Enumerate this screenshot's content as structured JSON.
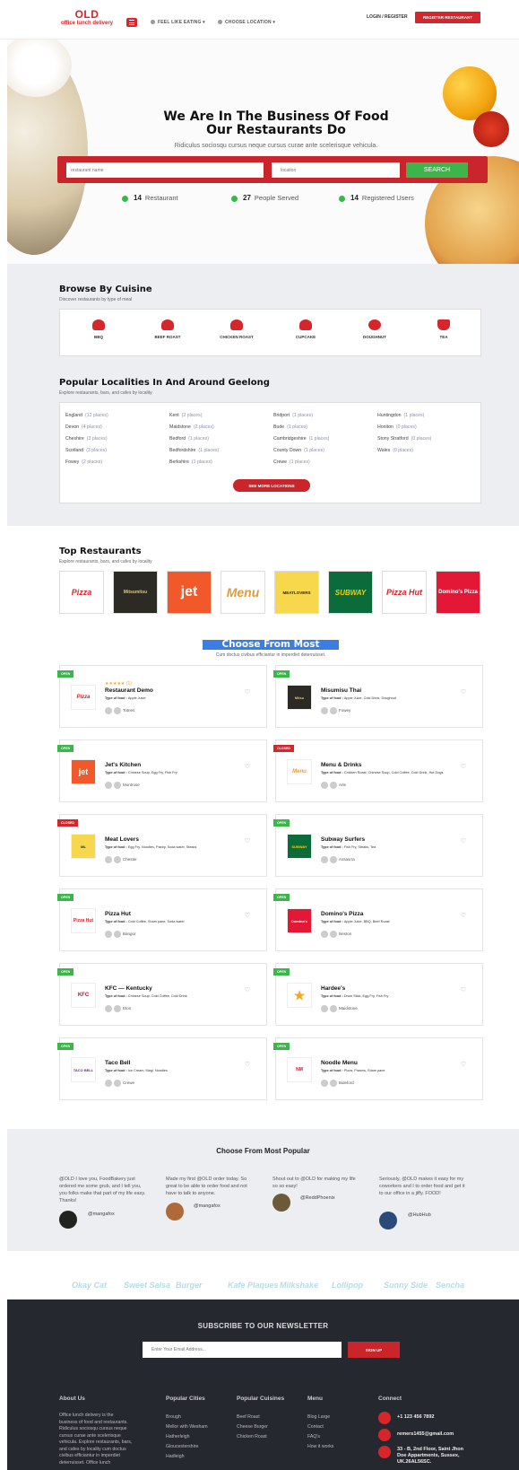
{
  "header": {
    "logo_main": "OLD",
    "logo_sub": "office lunch delivery",
    "nav_eating": "FEEL LIKE EATING",
    "nav_location": "CHOOSE LOCATION",
    "login": "LOGIN / REGISTER",
    "register": "REGISTER RESTAURANT"
  },
  "hero": {
    "title_line1": "We Are In The Business Of Food",
    "title_line2": "Our Restaurants Do",
    "subtitle": "Ridiculus sociosqu cursus neque cursus curae ante scelerisque vehicula.",
    "search_placeholder": "restaurant name",
    "location_placeholder": "location",
    "search_button": "SEARCH",
    "stats": [
      {
        "num": "14",
        "label": "Restaurant"
      },
      {
        "num": "27",
        "label": "People Served"
      },
      {
        "num": "14",
        "label": "Registered Users"
      }
    ]
  },
  "cuisine": {
    "title": "Browse By Cuisine",
    "subtitle": "Discover restaurants by type of meal",
    "items": [
      "BBQ",
      "BEEF ROAST",
      "CHICKEN ROAST",
      "CUPCAKE",
      "DOUGHNUT",
      "TEA"
    ]
  },
  "localities": {
    "title": "Popular Localities In And Around Geelong",
    "subtitle": "Explore restaurants, bars, and cafes by locality",
    "button": "SEE MORE LOCATIONS",
    "items": [
      [
        {
          "n": "England",
          "c": "(12 places)"
        },
        {
          "n": "Devon",
          "c": "(4 places)"
        },
        {
          "n": "Cheshire",
          "c": "(3 places)"
        },
        {
          "n": "Scotland",
          "c": "(3 places)"
        },
        {
          "n": "Fowey",
          "c": "(2 places)"
        }
      ],
      [
        {
          "n": "Kent",
          "c": "(2 places)"
        },
        {
          "n": "Maidstone",
          "c": "(2 places)"
        },
        {
          "n": "Bedford",
          "c": "(1 places)"
        },
        {
          "n": "Bedfordshire",
          "c": "(1 places)"
        },
        {
          "n": "Berkshire",
          "c": "(1 places)"
        }
      ],
      [
        {
          "n": "Bridport",
          "c": "(1 places)"
        },
        {
          "n": "Bude",
          "c": "(1 places)"
        },
        {
          "n": "Cambridgeshire",
          "c": "(1 places)"
        },
        {
          "n": "County Down",
          "c": "(1 places)"
        },
        {
          "n": "Crewe",
          "c": "(1 places)"
        }
      ],
      [
        {
          "n": "Huntingdon",
          "c": "(1 places)"
        },
        {
          "n": "Honiton",
          "c": "(0 places)"
        },
        {
          "n": "Stony Stratford",
          "c": "(0 places)"
        },
        {
          "n": "Wales",
          "c": "(0 places)"
        }
      ]
    ]
  },
  "top": {
    "title": "Top Restaurants",
    "subtitle": "Explore restaurants, bars, and cafes by locality",
    "logos": [
      "Pizza",
      "Mitsumitsu",
      "jet",
      "Menu",
      "MEATLOVERS",
      "SUBWAY",
      "Pizza Hut",
      "Domino's Pizza"
    ]
  },
  "popular": {
    "title": "Choose From Most Popular",
    "subtitle": "Cum doctus civibus efficiantur in imperdiet deterruisset.",
    "cards": [
      {
        "tag": "OPEN",
        "status": "open",
        "name": "Restaurant Demo",
        "type_label": "Type of food : ",
        "type": "Apple Juice",
        "place": "Totnes",
        "logo": "Pizza",
        "stars": "★★★★★ (1)"
      },
      {
        "tag": "OPEN",
        "status": "open",
        "name": "Misumisu Thai",
        "type_label": "Type of food : ",
        "type": "Apple Juice, Cold Drink, Doughnut",
        "place": "Fowey",
        "logo": "Mitsu"
      },
      {
        "tag": "OPEN",
        "status": "open",
        "name": "Jet's Kitchen",
        "type_label": "Type of food : ",
        "type": "Chinese Soup, Egg Fry, Fish Fry",
        "place": "Montrose",
        "logo": "jet"
      },
      {
        "tag": "CLOSED",
        "status": "closed",
        "name": "Menu & Drinks",
        "type_label": "Type of food : ",
        "type": "Chicken Roast, Chinese Soup, Cold Coffee, Cold Drink, Hot Dogs",
        "place": "Arle",
        "logo": "Menu"
      },
      {
        "tag": "CLOSED",
        "status": "closed",
        "name": "Meat Lovers",
        "type_label": "Type of food : ",
        "type": "Egg Fry, Noodles, Pastry, Soda water, Steaks",
        "place": "Chester",
        "logo": "ML"
      },
      {
        "tag": "OPEN",
        "status": "open",
        "name": "Subway Surfers",
        "type_label": "Type of food : ",
        "type": "Fish Fry, Steaks, Tea",
        "place": "Assasrra",
        "logo": "SUBWAY"
      },
      {
        "tag": "OPEN",
        "status": "open",
        "name": "Pizza Hut",
        "type_label": "Type of food : ",
        "type": "Cold Coffee, Sham pane, Soda water",
        "place": "Bangor",
        "logo": "Pizza Hut"
      },
      {
        "tag": "OPEN",
        "status": "open",
        "name": "Domino's Pizza",
        "type_label": "Type of food : ",
        "type": "Apple Juice, BBQ, Beef Roast",
        "place": "Neston",
        "logo": "Domino's"
      },
      {
        "tag": "OPEN",
        "status": "open",
        "name": "KFC — Kentucky",
        "type_label": "Type of food : ",
        "type": "Chinese Soup, Cold Coffee, Cold Drink",
        "place": "Eton",
        "logo": "KFC"
      },
      {
        "tag": "OPEN",
        "status": "open",
        "name": "Hardee's",
        "type_label": "Type of food : ",
        "type": "Drum Stick, Egg Fry, Fish Fry",
        "place": "Maidstone",
        "logo": "★"
      },
      {
        "tag": "OPEN",
        "status": "open",
        "name": "Taco Bell",
        "type_label": "Type of food : ",
        "type": "Ice Cream, Magi, Noodles",
        "place": "Crewe",
        "logo": "TACO BELL"
      },
      {
        "tag": "OPEN",
        "status": "open",
        "name": "Noodle Menu",
        "type_label": "Type of food : ",
        "type": "Pizza, Prawns, Sham pane",
        "place": "Bideford",
        "logo": "NM"
      }
    ]
  },
  "testimonials": {
    "title": "Choose From Most Popular",
    "items": [
      {
        "quote": "@OLD I love you, FoodBakery just ordered me some grub, and I tell you, you folks make that part of my life easy. Thanks!",
        "name": "@mangafox"
      },
      {
        "quote": "Made my first @OLD order today. So great to be able to order food and not have to talk to anyone.",
        "name": "@mangafox"
      },
      {
        "quote": "Shout out to @OLD for making my life so so easy!",
        "name": "@ReddPhoenix"
      },
      {
        "quote": "Seriously, @OLD makes it easy for my coworkers and I to order food and get it to our office in a jiffy. FOOD!",
        "name": "@HubHub"
      }
    ]
  },
  "brands": [
    "Okay Cat",
    "Sweet Salsa",
    "Burger",
    "Kafe Plaques",
    "Milkshake",
    "Lollipop",
    "Sunny Side",
    "Sencha"
  ],
  "footer": {
    "newsletter_title": "SUBSCRIBE TO OUR NEWSLETTER",
    "email_placeholder": "Enter Your Email Address...",
    "signup": "SIGN UP",
    "about_title": "About Us",
    "about_text": "Office lunch delivery is the business of food and restaurants. Ridiculus sociosqu cursus neque cursus curae ante scelerisque vehicula. Explore restaurants, bars, and cafes by locality cum doctus civibus efficiantur in imperdiet deterruisset. Office lunch",
    "cities_title": "Popular Cities",
    "cities": [
      "Brough",
      "Mellor with Wesham",
      "Hatherleigh",
      "Gloucestershire",
      "Hadleigh"
    ],
    "cuisines_title": "Popular Cuisines",
    "cuisines": [
      "Beef Roast",
      "Cheese Burger",
      "Chicken Roast"
    ],
    "menu_title": "Menu",
    "menu": [
      "Blog Large",
      "Contact",
      "FAQ's",
      "How it works"
    ],
    "connect_title": "Connect",
    "phone": "+1 123 456 7892",
    "email": "remers1455@gmail.com",
    "address_line1": "33 - B, 2nd Floor, Saint Jhon",
    "address_line2": "Doe Appartments, Sussex,",
    "address_line3": "UK.26AL56SC."
  }
}
